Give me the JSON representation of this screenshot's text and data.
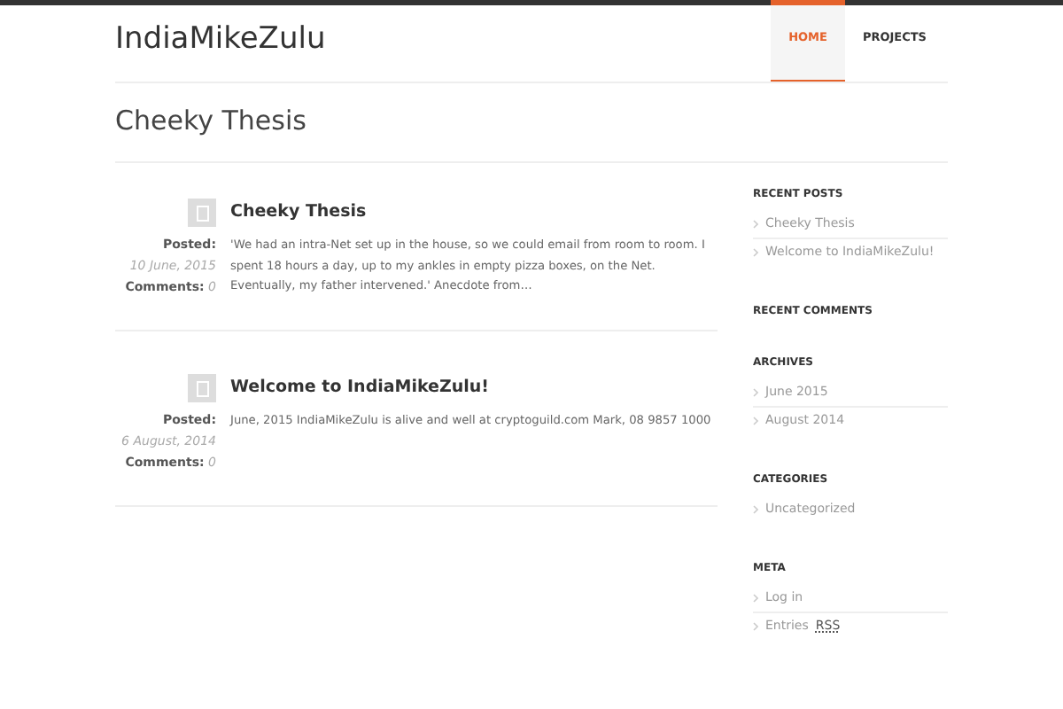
{
  "site_title": "IndiaMikeZulu",
  "nav": [
    {
      "label": "HOME",
      "selected": true
    },
    {
      "label": "PROJECTS",
      "selected": false
    }
  ],
  "page_title": "Cheeky Thesis",
  "posts": [
    {
      "title": "Cheeky Thesis",
      "posted_label": "Posted:",
      "date": "10 June, 2015",
      "comments_label": "Comments:",
      "comments": "0",
      "excerpt": "'We had an intra-Net set up in the house, so we could email from room to room. I spent 18 hours a day, up to my ankles in empty pizza boxes, on the Net. Eventually, my father intervened.' Anecdote from…"
    },
    {
      "title": "Welcome to IndiaMikeZulu!",
      "posted_label": "Posted:",
      "date": "6 August, 2014",
      "comments_label": "Comments:",
      "comments": "0",
      "excerpt": "June, 2015 IndiaMikeZulu is alive and well at cryptoguild.com Mark, 08 9857 1000"
    }
  ],
  "sidebar": [
    {
      "heading": "RECENT POSTS",
      "items": [
        {
          "label": "Cheeky Thesis"
        },
        {
          "label": "Welcome to IndiaMikeZulu!"
        }
      ]
    },
    {
      "heading": "RECENT COMMENTS"
    },
    {
      "heading": "ARCHIVES",
      "items": [
        {
          "label": "June 2015"
        },
        {
          "label": "August 2014"
        }
      ]
    },
    {
      "heading": "CATEGORIES",
      "items": [
        {
          "label": "Uncategorized"
        }
      ]
    },
    {
      "heading": "META",
      "items": [
        {
          "label": "Log in"
        },
        {
          "label": "Entries",
          "abbr": "RSS"
        }
      ]
    }
  ]
}
